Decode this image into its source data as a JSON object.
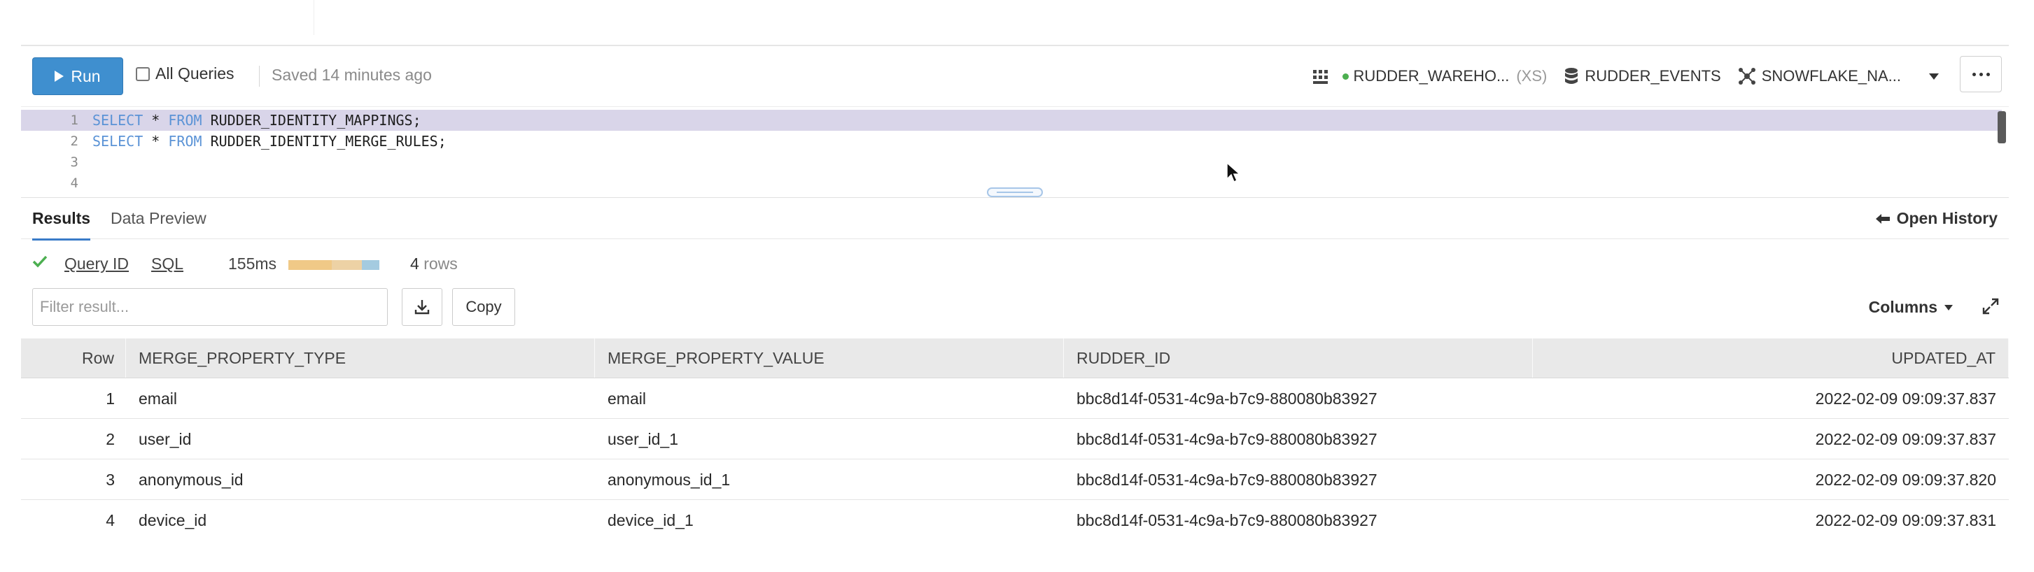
{
  "toolbar": {
    "run_label": "Run",
    "all_queries_label": "All Queries",
    "saved_status": "Saved 14 minutes ago",
    "warehouse": "RUDDER_WAREHO...",
    "warehouse_size": "(XS)",
    "database": "RUDDER_EVENTS",
    "schema": "SNOWFLAKE_NA..."
  },
  "editor": {
    "line_numbers": [
      "1",
      "2",
      "3",
      "4"
    ],
    "lines": [
      {
        "kw": "SELECT",
        "star": " * ",
        "kw2": "FROM",
        "rest": " RUDDER_IDENTITY_MAPPINGS;"
      },
      {
        "kw": "SELECT",
        "star": " * ",
        "kw2": "FROM",
        "rest": " RUDDER_IDENTITY_MERGE_RULES;"
      }
    ]
  },
  "results_tabs": {
    "results": "Results",
    "data_preview": "Data Preview",
    "open_history": "Open History"
  },
  "status": {
    "query_id": "Query ID",
    "sql": "SQL",
    "duration": "155ms",
    "row_count": "4",
    "row_label": "rows"
  },
  "filter": {
    "placeholder": "Filter result...",
    "copy_label": "Copy",
    "columns_label": "Columns"
  },
  "table": {
    "headers": [
      "Row",
      "MERGE_PROPERTY_TYPE",
      "MERGE_PROPERTY_VALUE",
      "RUDDER_ID",
      "UPDATED_AT"
    ],
    "rows": [
      [
        "1",
        "email",
        "email",
        "bbc8d14f-0531-4c9a-b7c9-880080b83927",
        "2022-02-09 09:09:37.837"
      ],
      [
        "2",
        "user_id",
        "user_id_1",
        "bbc8d14f-0531-4c9a-b7c9-880080b83927",
        "2022-02-09 09:09:37.837"
      ],
      [
        "3",
        "anonymous_id",
        "anonymous_id_1",
        "bbc8d14f-0531-4c9a-b7c9-880080b83927",
        "2022-02-09 09:09:37.820"
      ],
      [
        "4",
        "device_id",
        "device_id_1",
        "bbc8d14f-0531-4c9a-b7c9-880080b83927",
        "2022-02-09 09:09:37.831"
      ]
    ]
  },
  "colors": {
    "run_button": "#3f8fcf",
    "keyword": "#5b93d6",
    "line_highlight": "#d9d5e9",
    "active_tab": "#3a7bc8",
    "success": "#4caf50"
  }
}
